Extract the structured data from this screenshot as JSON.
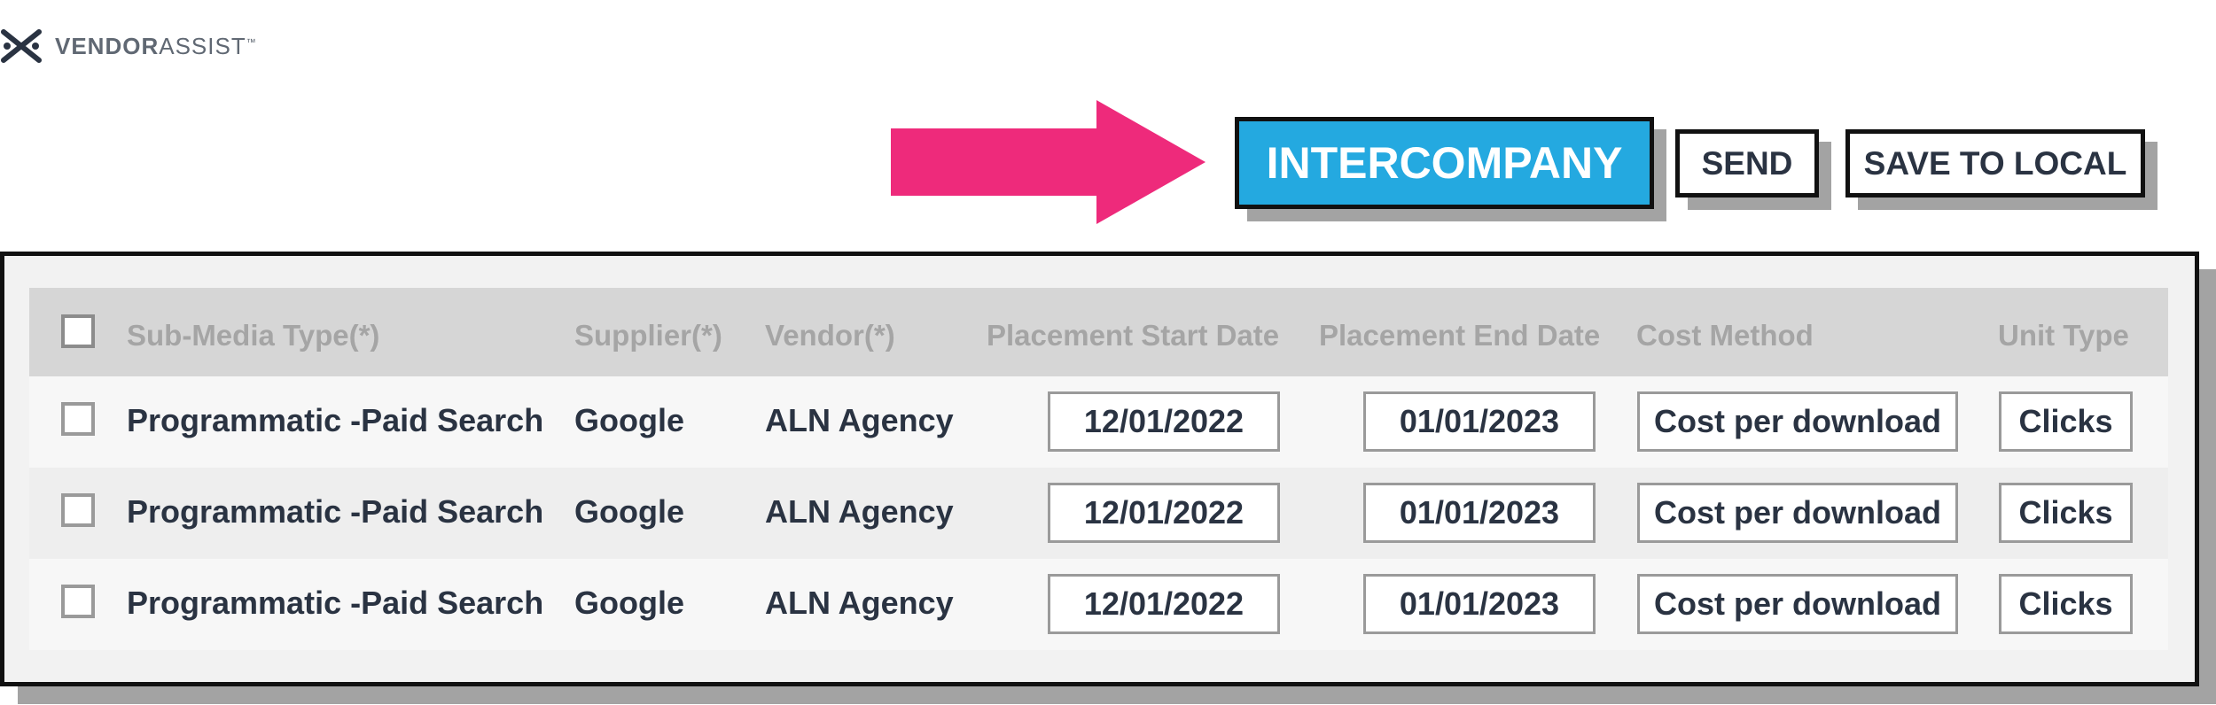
{
  "brand": {
    "name_bold": "VENDOR",
    "name_rest": "ASSIST",
    "trademark": "™"
  },
  "colors": {
    "arrow": "#ee2a7b",
    "primary_button": "#24a9e0",
    "text": "#2a3342",
    "header_text": "#a5a5a5",
    "shadow": "#a3a3a3"
  },
  "actions": {
    "intercompany_label": "INTERCOMPANY",
    "send_label": "SEND",
    "save_label": "SAVE TO LOCAL"
  },
  "table": {
    "columns": {
      "sub_media_type": "Sub-Media Type(*)",
      "supplier": "Supplier(*)",
      "vendor": "Vendor(*)",
      "placement_start": "Placement Start Date",
      "placement_end": "Placement End Date",
      "cost_method": "Cost Method",
      "unit_type": "Unit Type"
    },
    "rows": [
      {
        "sub_media_type": "Programmatic -Paid Search",
        "supplier": "Google",
        "vendor": "ALN Agency",
        "placement_start": "12/01/2022",
        "placement_end": "01/01/2023",
        "cost_method": "Cost per download",
        "unit_type": "Clicks"
      },
      {
        "sub_media_type": "Programmatic -Paid Search",
        "supplier": "Google",
        "vendor": "ALN Agency",
        "placement_start": "12/01/2022",
        "placement_end": "01/01/2023",
        "cost_method": "Cost per download",
        "unit_type": "Clicks"
      },
      {
        "sub_media_type": "Programmatic -Paid Search",
        "supplier": "Google",
        "vendor": "ALN Agency",
        "placement_start": "12/01/2022",
        "placement_end": "01/01/2023",
        "cost_method": "Cost per download",
        "unit_type": "Clicks"
      }
    ]
  }
}
